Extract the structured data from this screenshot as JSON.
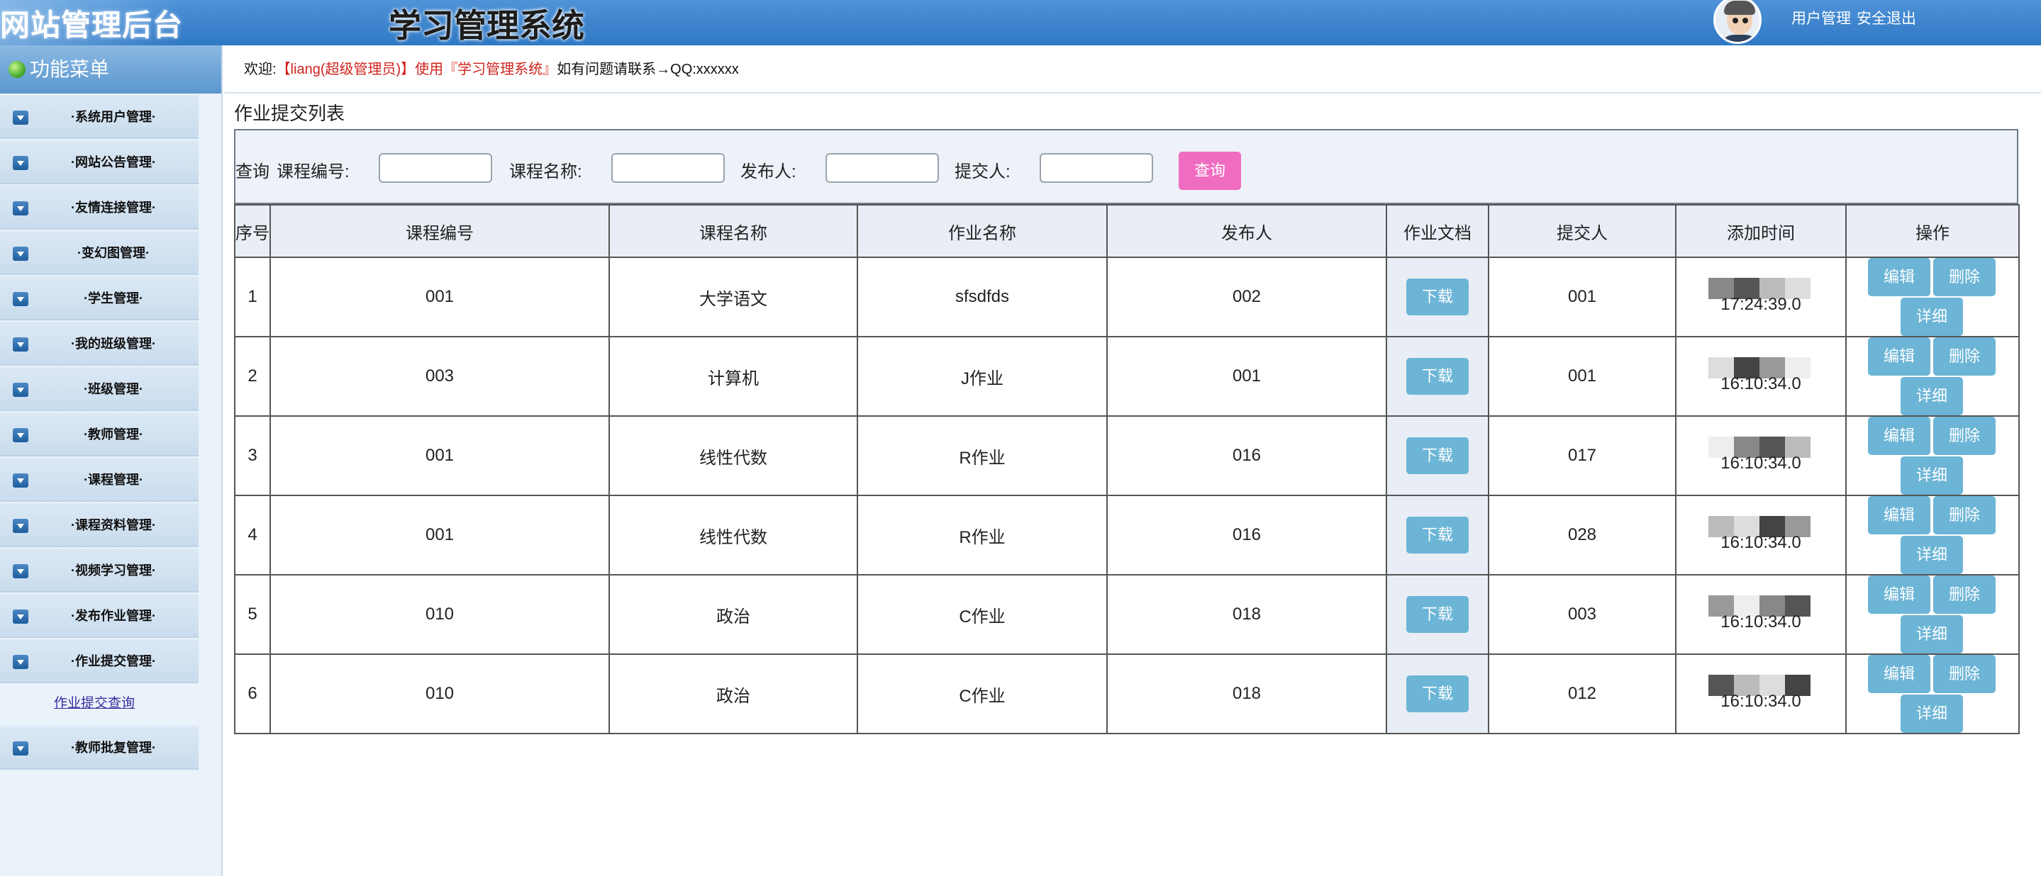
{
  "header": {
    "site_title": "网站管理后台",
    "system_title": "学习管理系统",
    "user_manage": "用户管理",
    "logout": "安全退出"
  },
  "sidebar": {
    "title": "功能菜单",
    "items": [
      {
        "label": "·系统用户管理·"
      },
      {
        "label": "·网站公告管理·"
      },
      {
        "label": "·友情连接管理·"
      },
      {
        "label": "·变幻图管理·"
      },
      {
        "label": "·学生管理·"
      },
      {
        "label": "·我的班级管理·"
      },
      {
        "label": "·班级管理·"
      },
      {
        "label": "·教师管理·"
      },
      {
        "label": "·课程管理·"
      },
      {
        "label": "·课程资料管理·"
      },
      {
        "label": "·视频学习管理·"
      },
      {
        "label": "·发布作业管理·"
      },
      {
        "label": "·作业提交管理·"
      }
    ],
    "sub_item": "作业提交查询",
    "last_item": "·教师批复管理·"
  },
  "welcome": {
    "prefix": "欢迎:",
    "user": "【liang(超级管理员)】使用『学习管理系统』",
    "suffix": "如有问题请联系→QQ:xxxxxx"
  },
  "main": {
    "list_title": "作业提交列表",
    "search": {
      "query_label": "查询",
      "course_no_label": "课程编号:",
      "course_name_label": "课程名称:",
      "publisher_label": "发布人:",
      "submitter_label": "提交人:",
      "button": "查询"
    },
    "columns": [
      "序号",
      "课程编号",
      "课程名称",
      "作业名称",
      "发布人",
      "作业文档",
      "提交人",
      "添加时间",
      "操作"
    ],
    "download_label": "下载",
    "edit_label": "编辑",
    "delete_label": "删除",
    "detail_label": "详细",
    "rows": [
      {
        "no": "1",
        "course_no": "001",
        "course_name": "大学语文",
        "hw_name": "sfsdfds",
        "publisher": "002",
        "submitter": "001",
        "time": "17:24:39.0"
      },
      {
        "no": "2",
        "course_no": "003",
        "course_name": "计算机",
        "hw_name": "J作业",
        "publisher": "001",
        "submitter": "001",
        "time": "16:10:34.0"
      },
      {
        "no": "3",
        "course_no": "001",
        "course_name": "线性代数",
        "hw_name": "R作业",
        "publisher": "016",
        "submitter": "017",
        "time": "16:10:34.0"
      },
      {
        "no": "4",
        "course_no": "001",
        "course_name": "线性代数",
        "hw_name": "R作业",
        "publisher": "016",
        "submitter": "028",
        "time": "16:10:34.0"
      },
      {
        "no": "5",
        "course_no": "010",
        "course_name": "政治",
        "hw_name": "C作业",
        "publisher": "018",
        "submitter": "003",
        "time": "16:10:34.0"
      },
      {
        "no": "6",
        "course_no": "010",
        "course_name": "政治",
        "hw_name": "C作业",
        "publisher": "018",
        "submitter": "012",
        "time": "16:10:34.0"
      }
    ]
  },
  "colors": {
    "header_blue": "#2f78c4",
    "query_button": "#f06cc0",
    "action_button": "#6cb5d6",
    "welcome_red": "#d0241e"
  }
}
